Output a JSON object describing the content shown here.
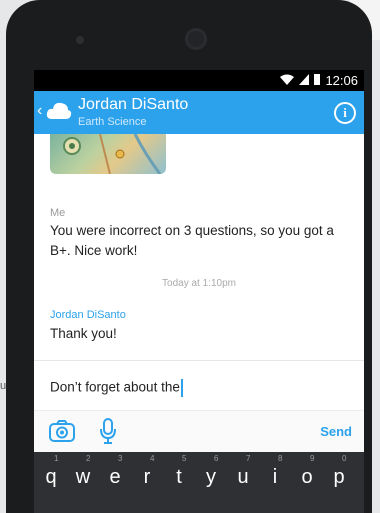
{
  "background": {
    "side_text": "u."
  },
  "status": {
    "time": "12:06"
  },
  "header": {
    "contact_name": "Jordan DiSanto",
    "subject": "Earth Science",
    "info_icon": "i"
  },
  "messages": {
    "me_label": "Me",
    "me_text": "You were incorrect on 3 questions, so you got a B+. Nice work!",
    "timestamp": "Today at 1:10pm",
    "them_label": "Jordan DiSanto",
    "them_text": "Thank you!"
  },
  "composer": {
    "value": "Don’t forget about the",
    "send_label": "Send"
  },
  "keyboard": {
    "keys": [
      "q",
      "w",
      "e",
      "r",
      "t",
      "y",
      "u",
      "i",
      "o",
      "p"
    ],
    "numbers": [
      "1",
      "2",
      "3",
      "4",
      "5",
      "6",
      "7",
      "8",
      "9",
      "0"
    ]
  },
  "colors": {
    "accent": "#2ca2ec"
  }
}
